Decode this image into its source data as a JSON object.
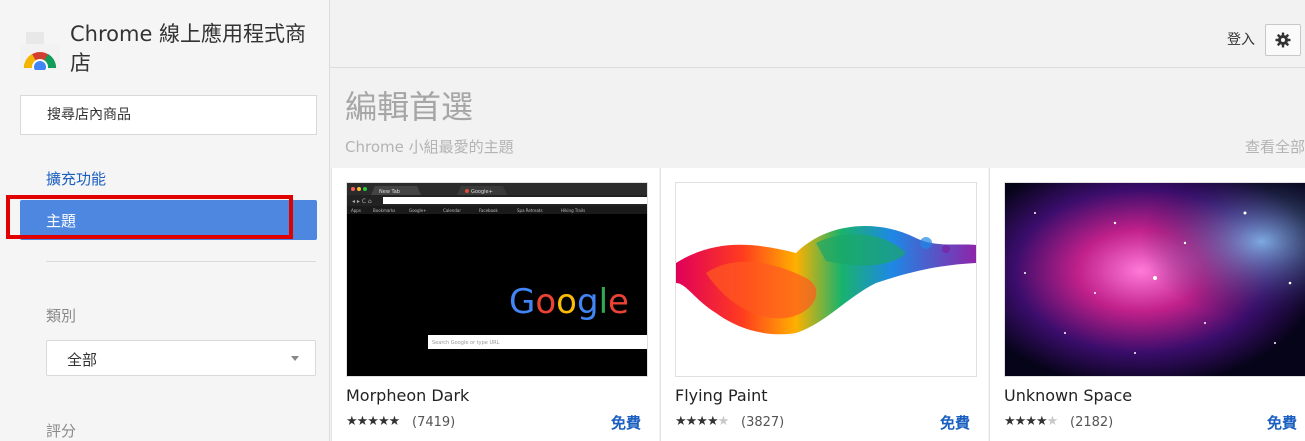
{
  "store": {
    "title": "Chrome 線上應用程式商店"
  },
  "search": {
    "placeholder": "搜尋店內商品"
  },
  "nav": {
    "extensions_label": "擴充功能",
    "themes_label": "主題"
  },
  "filters": {
    "category_label": "類別",
    "category_value": "全部",
    "rating_label": "評分"
  },
  "topbar": {
    "signin_label": "登入",
    "settings_icon": "gear-icon"
  },
  "section": {
    "title": "編輯首選",
    "subtitle": "Chrome 小組最愛的主題",
    "view_all": "查看全部"
  },
  "preview": {
    "tab1": "New Tab",
    "tab2": "Google+",
    "bookmarks": [
      "Apps",
      "Bookmarks",
      "Google+",
      "Calendar",
      "Facebook",
      "Spa Retreats",
      "Hiking Trails"
    ],
    "logo_text": "Google",
    "search_placeholder": "Search Google or type URL"
  },
  "cards": [
    {
      "name": "Morpheon Dark",
      "stars": "★★★★★",
      "rating": 4.5,
      "count": "(7419)",
      "price": "免費"
    },
    {
      "name": "Flying Paint",
      "stars": "★★★★",
      "stars_empty": "★",
      "rating": 4,
      "count": "(3827)",
      "price": "免費"
    },
    {
      "name": "Unknown Space",
      "stars": "★★★★",
      "stars_empty": "★",
      "rating": 4,
      "count": "(2182)",
      "price": "免費"
    }
  ],
  "colors": {
    "accent": "#4d87e0",
    "link": "#1a5fc0",
    "highlight": "#e00000"
  }
}
